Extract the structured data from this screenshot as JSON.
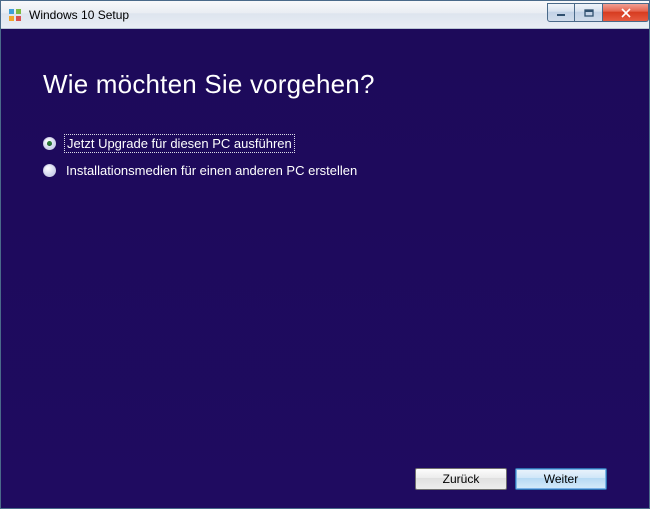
{
  "window": {
    "title": "Windows 10 Setup"
  },
  "heading": "Wie möchten Sie vorgehen?",
  "options": {
    "upgrade": {
      "label": "Jetzt Upgrade für diesen PC ausführen",
      "selected": true
    },
    "media": {
      "label": "Installationsmedien für einen anderen PC erstellen",
      "selected": false
    }
  },
  "footer": {
    "back": "Zurück",
    "next": "Weiter"
  }
}
